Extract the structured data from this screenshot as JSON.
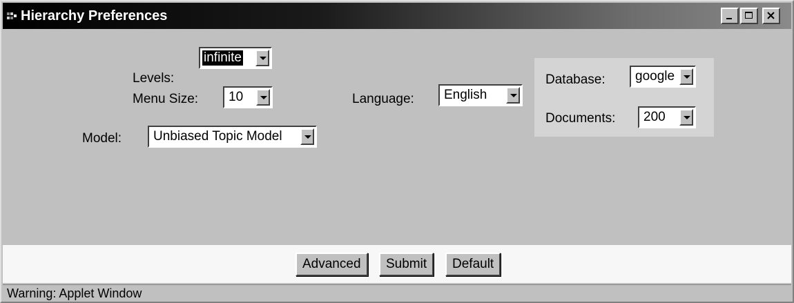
{
  "window": {
    "title": "Hierarchy Preferences"
  },
  "form": {
    "levels": {
      "label": "Levels:",
      "value": "infinite"
    },
    "menu_size": {
      "label": "Menu Size:",
      "value": "10"
    },
    "language": {
      "label": "Language:",
      "value": "English"
    },
    "model": {
      "label": "Model:",
      "value": "Unbiased Topic Model"
    },
    "database": {
      "label": "Database:",
      "value": "google"
    },
    "documents": {
      "label": "Documents:",
      "value": "200"
    }
  },
  "buttons": {
    "advanced": "Advanced",
    "submit": "Submit",
    "default": "Default"
  },
  "status": {
    "text": "Warning: Applet Window"
  },
  "colors": {
    "window_bg": "#c0c0c0",
    "title_bar_start": "#000000",
    "panel_bg": "#d4d4d4",
    "button_bar_bg": "#f7f7f7"
  },
  "icons": [
    "app-icon",
    "minimize-icon",
    "maximize-icon",
    "close-icon",
    "chevron-down-icon"
  ]
}
